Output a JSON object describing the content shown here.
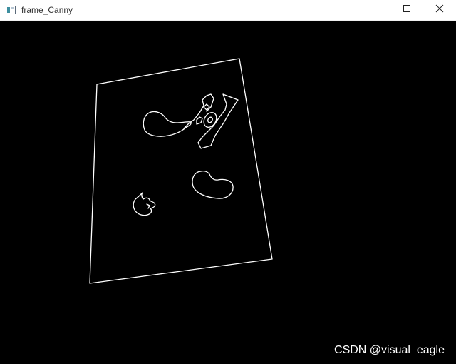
{
  "window": {
    "title": "frame_Canny",
    "icon": "opencv-window-icon",
    "controls": {
      "minimize_icon": "minimize-icon",
      "maximize_icon": "maximize-icon",
      "close_icon": "close-icon"
    }
  },
  "image": {
    "description_kind": "canny-edge-output",
    "edge_color": "#ffffff",
    "background_color": "#000000"
  },
  "watermark": {
    "text": "CSDN @visual_eagle"
  }
}
